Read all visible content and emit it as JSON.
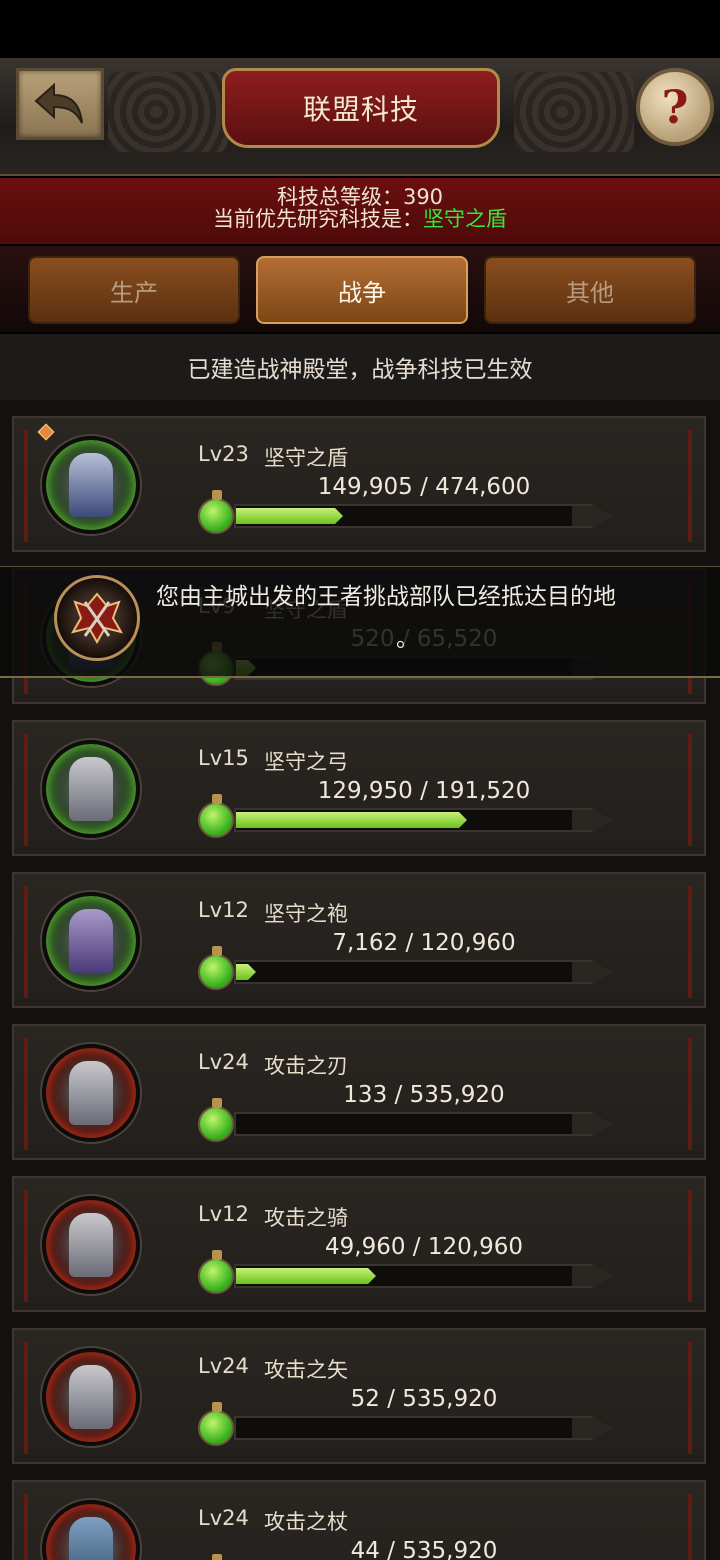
{
  "header": {
    "title": "联盟科技",
    "back_icon": "back-arrow-icon",
    "help_label": "?"
  },
  "summary": {
    "total_level_label": "科技总等级：390",
    "priority_label": "当前优先研究科技是：",
    "priority_tech": "坚守之盾",
    "priority_color": "#36e83a"
  },
  "tabs": [
    {
      "label": "生产",
      "active": false
    },
    {
      "label": "战争",
      "active": true
    },
    {
      "label": "其他",
      "active": false
    }
  ],
  "notice": "已建造战神殿堂，战争科技已生效",
  "toast": {
    "line1": "您由主城出发的王者挑战部队已经抵达目的地",
    "line2": "。"
  },
  "techs": [
    {
      "level": "Lv23",
      "name": "坚守之盾",
      "progress": "149,905 / 474,600",
      "fill_fraction": 0.316,
      "theme": "green",
      "has_gem": true
    },
    {
      "level": "Lv9",
      "name": "坚守之盾",
      "progress": "520 / 65,520",
      "fill_fraction": 0.008,
      "theme": "green",
      "has_gem": false
    },
    {
      "level": "Lv15",
      "name": "坚守之弓",
      "progress": "129,950 / 191,520",
      "fill_fraction": 0.679,
      "theme": "green",
      "has_gem": false
    },
    {
      "level": "Lv12",
      "name": "坚守之袍",
      "progress": "7,162 / 120,960",
      "fill_fraction": 0.059,
      "theme": "green",
      "has_gem": false
    },
    {
      "level": "Lv24",
      "name": "攻击之刃",
      "progress": "133 / 535,920",
      "fill_fraction": 0.0,
      "theme": "red",
      "has_gem": false
    },
    {
      "level": "Lv12",
      "name": "攻击之骑",
      "progress": "49,960 / 120,960",
      "fill_fraction": 0.413,
      "theme": "red",
      "has_gem": false
    },
    {
      "level": "Lv24",
      "name": "攻击之矢",
      "progress": "52 / 535,920",
      "fill_fraction": 0.0,
      "theme": "red",
      "has_gem": false
    },
    {
      "level": "Lv24",
      "name": "攻击之杖",
      "progress": "44 / 535,920",
      "fill_fraction": 0.0,
      "theme": "red",
      "has_gem": false
    }
  ]
}
